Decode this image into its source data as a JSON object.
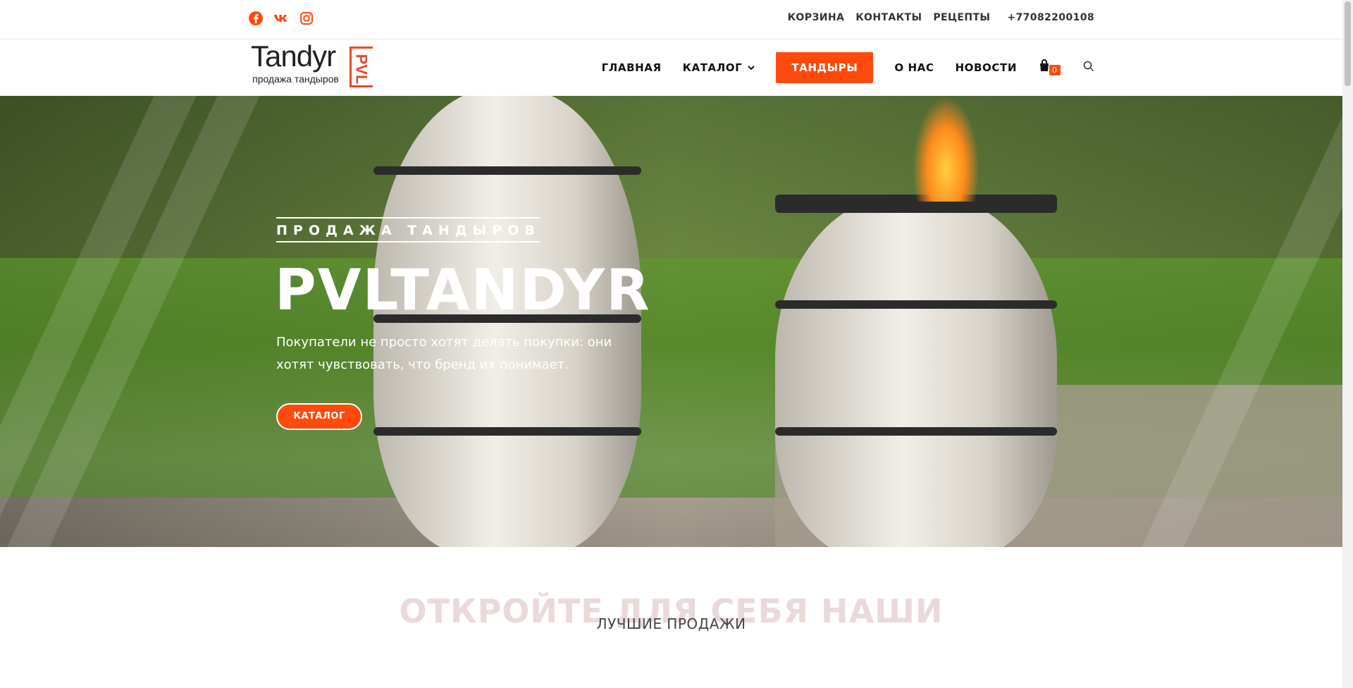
{
  "topbar": {
    "social": [
      {
        "name": "facebook-icon",
        "color": "#ff4a0d"
      },
      {
        "name": "vk-icon",
        "color": "#ff4a0d"
      },
      {
        "name": "instagram-icon",
        "color": "#ff4a0d"
      }
    ],
    "links": [
      "КОРЗИНА",
      "КОНТАКТЫ",
      "РЕЦЕПТЫ"
    ],
    "phone": "+77082200108"
  },
  "logo": {
    "title": "Tandyr",
    "subtitle": "продажа тандыров",
    "mark": "PVL"
  },
  "nav": {
    "home": "ГЛАВНАЯ",
    "catalog": "КАТАЛОГ",
    "tandyrs": "ТАНДЫРЫ",
    "about": "О НАС",
    "news": "НОВОСТИ",
    "cart_count": "0"
  },
  "hero": {
    "kicker": "ПРОДАЖА ТАНДЫРОВ",
    "title": "PVLTANDYR",
    "text": "Покупатели не просто хотят делать покупки: они хотят чувствовать, что бренд их понимает.",
    "button": "КАТАЛОГ"
  },
  "section": {
    "background_title": "ОТКРОЙТЕ ДЛЯ СЕБЯ НАШИ",
    "subtitle": "ЛУЧШИЕ ПРОДАЖИ"
  },
  "colors": {
    "accent": "#ff4a0d"
  }
}
